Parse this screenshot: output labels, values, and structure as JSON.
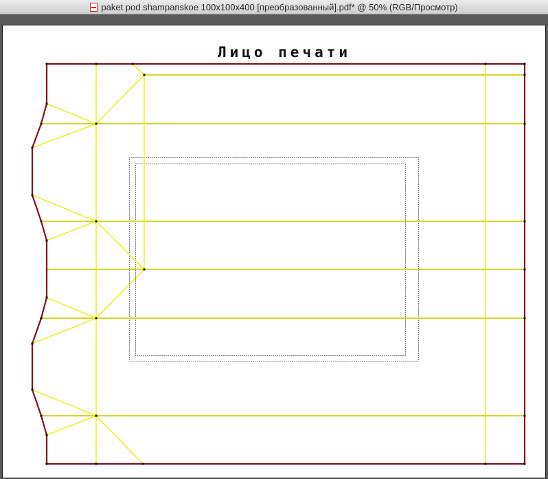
{
  "window": {
    "title": "paket pod shampanskoe 100x100x400 [преобразованный].pdf* @ 50% (RGB/Просмотр)"
  },
  "artboard": {
    "heading": "Лицо печати"
  },
  "colors": {
    "titlebar_text": "#2b2b2b",
    "pasteboard": "#5a5a5a",
    "cut_line": "#8b0a1a",
    "fold_line": "#f0ee00",
    "trim_box": "#000000"
  },
  "icons": {
    "document": "pdf-document-icon"
  }
}
